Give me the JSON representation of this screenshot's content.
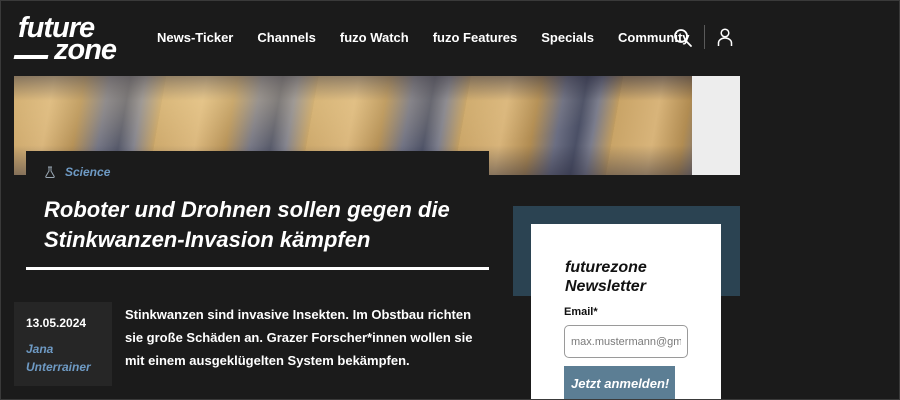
{
  "header": {
    "logo": {
      "line1": "future",
      "line2": "zone"
    },
    "nav": [
      "News-Ticker",
      "Channels",
      "fuzo Watch",
      "fuzo Features",
      "Specials",
      "Community"
    ],
    "icons": {
      "search": "search-icon",
      "user": "user-icon"
    }
  },
  "article": {
    "category": "Science",
    "category_icon": "flask-icon",
    "title": "Roboter und Drohnen sollen gegen die Stinkwanzen-Invasion kämpfen",
    "date": "13.05.2024",
    "author": "Jana Unterrainer",
    "teaser": "Stinkwanzen sind invasive Insekten. Im Obstbau richten sie große Schäden an. Grazer Forscher*innen wollen sie mit einem ausgeklügelten System bekämpfen."
  },
  "newsletter": {
    "title": "futurezone Newsletter",
    "email_label": "Email*",
    "email_placeholder": "max.mustermann@gmx.at",
    "button_label": "Jetzt anmelden!"
  },
  "colors": {
    "background": "#1b1b1b",
    "accent_blue": "#6e9ac4",
    "newsletter_band": "#2b4352",
    "button": "#5c7e94"
  }
}
